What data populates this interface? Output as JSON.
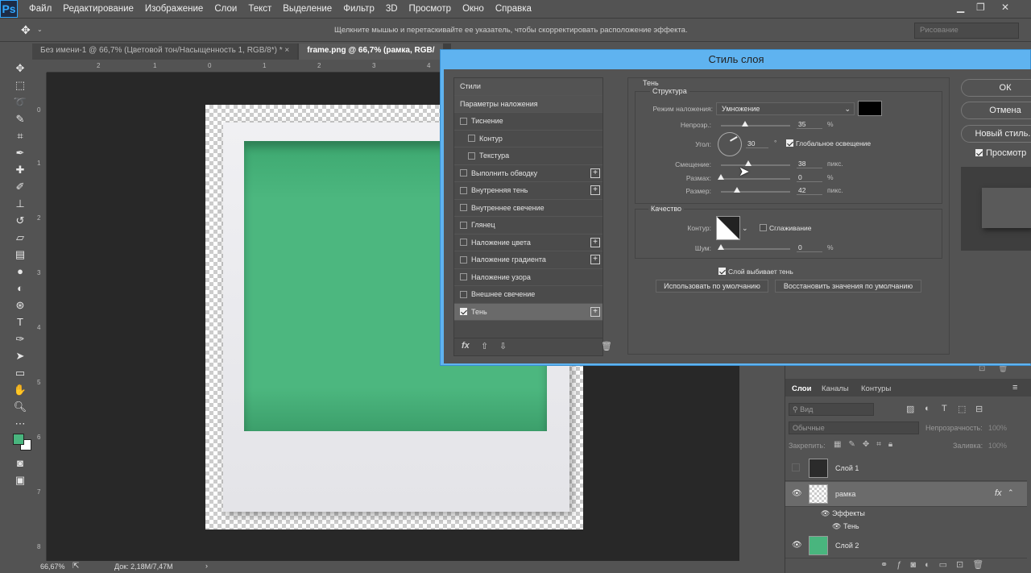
{
  "app": {
    "logo": "Ps"
  },
  "menu": [
    "Файл",
    "Редактирование",
    "Изображение",
    "Слои",
    "Текст",
    "Выделение",
    "Фильтр",
    "3D",
    "Просмотр",
    "Окно",
    "Справка"
  ],
  "options_bar": {
    "hint": "Щелкните мышью и перетаскивайте ее указатель, чтобы скорректировать расположение эффекта.",
    "workspace": "Рисование"
  },
  "tabs": [
    {
      "label": "Без имени-1 @ 66,7% (Цветовой тон/Насыщенность 1, RGB/8*) *",
      "close": "×"
    },
    {
      "label": "frame.png @ 66,7% (рамка, RGB/",
      "close": ""
    }
  ],
  "status": {
    "zoom": "66,67%",
    "doc": "Док: 2,18M/7,47M"
  },
  "colors": {
    "foreground": "#49b57e",
    "background": "#ffffff",
    "dialog_title": "#5fb3f0"
  },
  "dialog": {
    "title": "Стиль слоя",
    "list_header": "Стили",
    "blend_options": "Параметры наложения",
    "styles": [
      {
        "label": "Тиснение",
        "checked": false,
        "plus": false,
        "indent": false
      },
      {
        "label": "Контур",
        "checked": false,
        "plus": false,
        "indent": true
      },
      {
        "label": "Текстура",
        "checked": false,
        "plus": false,
        "indent": true
      },
      {
        "label": "Выполнить обводку",
        "checked": false,
        "plus": true,
        "indent": false
      },
      {
        "label": "Внутренняя тень",
        "checked": false,
        "plus": true,
        "indent": false
      },
      {
        "label": "Внутреннее свечение",
        "checked": false,
        "plus": false,
        "indent": false
      },
      {
        "label": "Глянец",
        "checked": false,
        "plus": false,
        "indent": false
      },
      {
        "label": "Наложение цвета",
        "checked": false,
        "plus": true,
        "indent": false
      },
      {
        "label": "Наложение градиента",
        "checked": false,
        "plus": true,
        "indent": false
      },
      {
        "label": "Наложение узора",
        "checked": false,
        "plus": false,
        "indent": false
      },
      {
        "label": "Внешнее свечение",
        "checked": false,
        "plus": false,
        "indent": false
      },
      {
        "label": "Тень",
        "checked": true,
        "plus": true,
        "indent": false
      }
    ],
    "footer_fx": "fx",
    "section": "Тень",
    "structure": {
      "title": "Структура",
      "blend_mode_label": "Режим наложения:",
      "blend_mode": "Умножение",
      "opacity_label": "Непрозр.:",
      "opacity": "35",
      "opacity_unit": "%",
      "angle_label": "Угол:",
      "angle": "30",
      "angle_unit": "°",
      "global_light_label": "Глобальное освещение",
      "distance_label": "Смещение:",
      "distance": "38",
      "distance_unit": "пикс.",
      "spread_label": "Размах:",
      "spread": "0",
      "spread_unit": "%",
      "size_label": "Размер:",
      "size": "42",
      "size_unit": "пикс."
    },
    "quality": {
      "title": "Качество",
      "contour_label": "Контур:",
      "antialias_label": "Сглаживание",
      "noise_label": "Шум:",
      "noise": "0",
      "noise_unit": "%"
    },
    "knockout_label": "Слой выбивает тень",
    "make_default": "Использовать по умолчанию",
    "reset_default": "Восстановить значения по умолчанию",
    "ok": "ОК",
    "cancel": "Отмена",
    "new_style": "Новый стиль...",
    "preview": "Просмотр"
  },
  "layers_panel": {
    "tabs": [
      "Слои",
      "Каналы",
      "Контуры"
    ],
    "kind_placeholder": "Вид",
    "blend": "Обычные",
    "opacity_label": "Непрозрачность:",
    "opacity": "100%",
    "lock_label": "Закрепить:",
    "fill_label": "Заливка:",
    "fill": "100%",
    "layers": [
      {
        "name": "Слой 1",
        "visible": false
      },
      {
        "name": "рамка",
        "visible": true,
        "fx": "fx"
      },
      {
        "name": "Слой 2",
        "visible": true
      }
    ],
    "effects_label": "Эффекты",
    "effect_shadow": "Тень"
  }
}
